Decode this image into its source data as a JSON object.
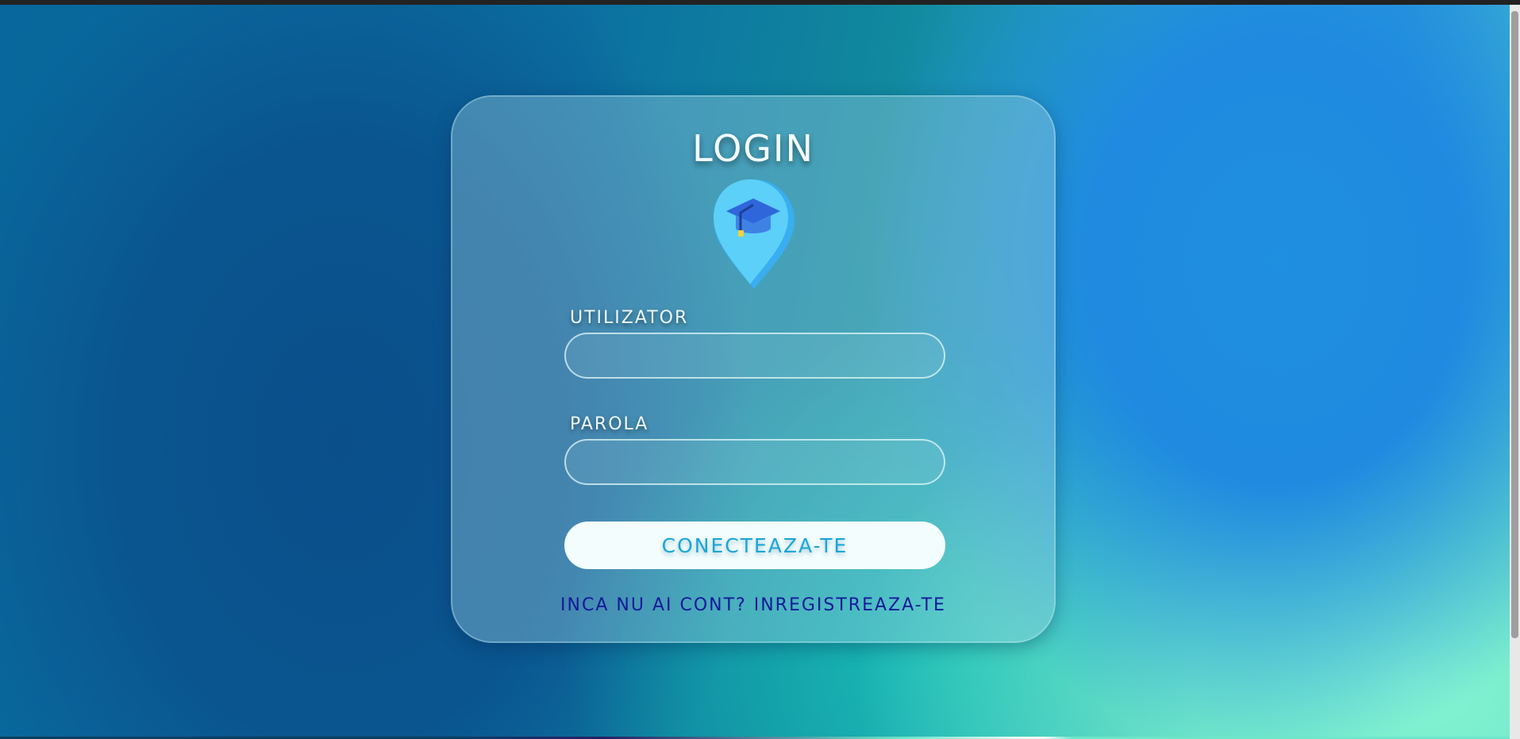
{
  "login": {
    "title": "LOGIN",
    "logo_icon": "graduation-cap-location-pin-icon",
    "username_label": "UTILIZATOR",
    "username_value": "",
    "password_label": "PAROLA",
    "password_value": "",
    "submit_label": "CONECTEAZA-TE",
    "register_link": "INCA NU AI CONT? INREGISTREAZA-TE"
  },
  "colors": {
    "accent": "#1aa6d6",
    "link": "#13199a",
    "button_bg": "#f3fdfd",
    "card_bg": "rgba(160,210,225,0.38)"
  }
}
